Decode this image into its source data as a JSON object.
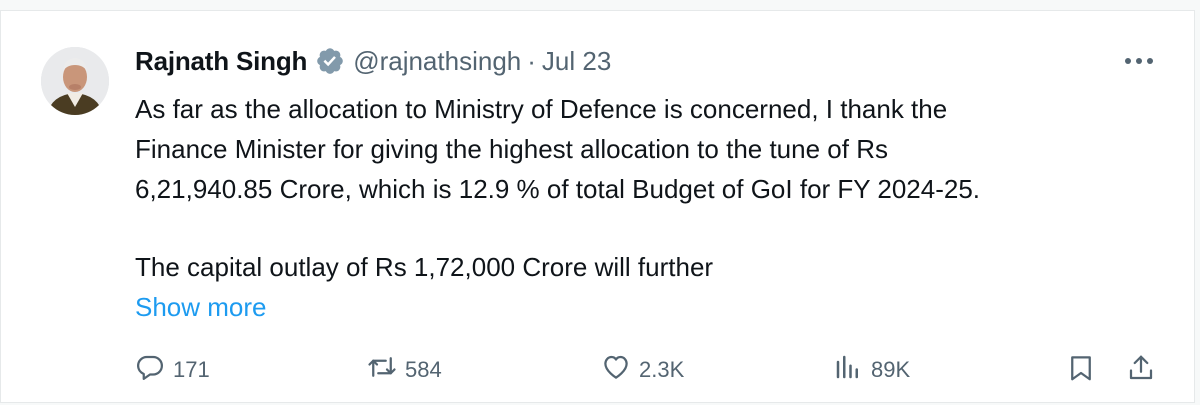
{
  "tweet": {
    "author_name": "Rajnath Singh",
    "handle": "@rajnathsingh",
    "separator": "·",
    "date": "Jul 23",
    "body_lines": [
      "As far as the allocation to Ministry of Defence is concerned, I thank the",
      "Finance Minister for giving the highest allocation to the tune of Rs",
      "6,21,940.85 Crore, which is 12.9 % of total Budget of GoI for FY 2024-25."
    ],
    "body_line_4": "The capital outlay of Rs 1,72,000 Crore will further",
    "show_more_label": "Show more"
  },
  "actions": {
    "replies": "171",
    "reposts": "584",
    "likes": "2.3K",
    "views": "89K"
  },
  "icons": {
    "verified": "verified-badge-icon",
    "more": "more-options-icon",
    "reply": "reply-icon",
    "repost": "repost-icon",
    "like": "heart-icon",
    "views": "views-icon",
    "bookmark": "bookmark-icon",
    "share": "share-icon"
  },
  "colors": {
    "link": "#1d9bf0",
    "secondary_text": "#536471",
    "verified_badge": "#829aab"
  }
}
